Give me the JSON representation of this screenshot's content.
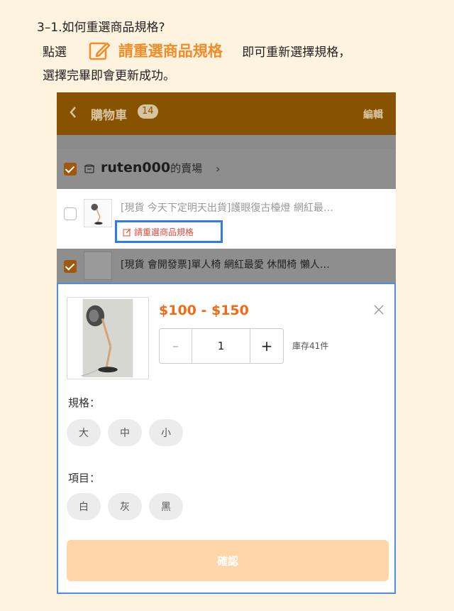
{
  "guide": {
    "title": "3–1.如何重選商品規格?",
    "line1_prefix": "點選",
    "line1_highlight": "請重選商品規格",
    "line1_suffix": "即可重新選擇規格，",
    "line2": "選擇完畢即會更新成功。"
  },
  "topbar": {
    "title": "購物車",
    "badge": "14",
    "edit": "編輯"
  },
  "store": {
    "name": "ruten000",
    "suffix": "的賣場"
  },
  "items": [
    {
      "name": "[現貨 今天下定明天出貨]護眼復古檯燈 網紅最…"
    },
    {
      "name": "[現貨 會開發票]單人椅 網紅最愛 休閒椅 懶人…"
    }
  ],
  "reselect_link": "請重選商品規格",
  "sheet": {
    "price": "$100 - $150",
    "quantity": "1",
    "minus": "–",
    "plus": "+",
    "stock": "庫存41件",
    "spec_label": "規格：",
    "spec_options": [
      "大",
      "中",
      "小"
    ],
    "item_label": "項目：",
    "item_options": [
      "白",
      "灰",
      "黑"
    ],
    "confirm": "確認"
  },
  "colors": {
    "accent_orange": "#f08d2a",
    "price": "#f26a16",
    "highlight_border": "#2f7de0",
    "topbar": "#885300"
  },
  "icons": [
    "edit-icon",
    "back-chevron-icon",
    "store-icon",
    "close-icon",
    "lamp-image"
  ]
}
